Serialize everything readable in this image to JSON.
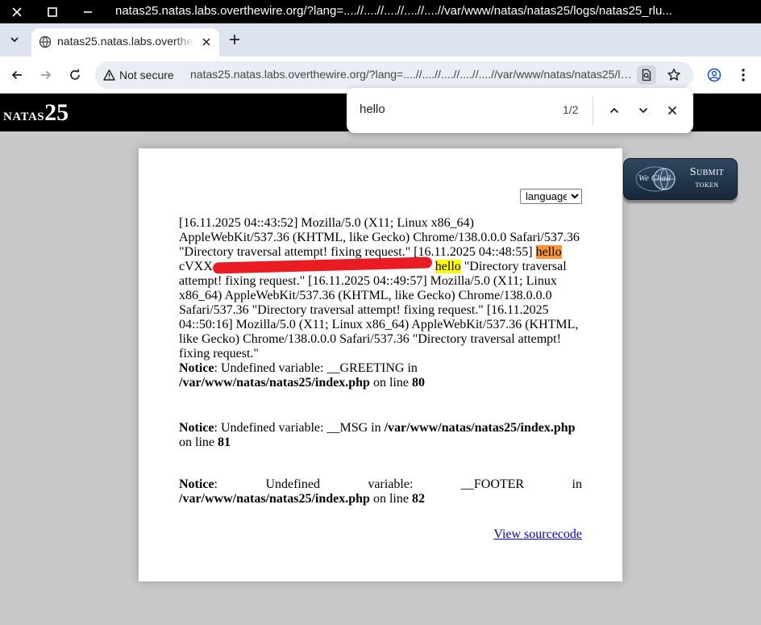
{
  "window": {
    "title": "natas25.natas.labs.overthewire.org/?lang=....//....//....//....//....//var/www/natas/natas25/logs/natas25_rlu..."
  },
  "tab": {
    "title": "natas25.natas.labs.overthewire.org"
  },
  "toolbar": {
    "security_label": "Not secure",
    "url": "natas25.natas.labs.overthewire.org/?lang=....//....//....//....//....//var/www/natas/natas25/logs/natas25_rlu..."
  },
  "find": {
    "query": "hello",
    "count": "1/2"
  },
  "site": {
    "logo_prefix": "natas",
    "logo_number": "25",
    "language_label": "language",
    "log_1": "[16.11.2025 04::43:52] Mozilla/5.0 (X11; Linux x86_64) AppleWebKit/537.36 (KHTML, like Gecko) Chrome/138.0.0.0 Safari/537.36 \"Directory traversal attempt! fixing request.\" [16.11.2025 04::48:55] ",
    "match_1": "hello",
    "redacted_prefix": "cVXX",
    "match_2": "hello",
    "log_2": " \"Directory traversal attempt! fixing request.\" [16.11.2025 04::49:57] Mozilla/5.0 (X11; Linux x86_64) AppleWebKit/537.36 (KHTML, like Gecko) Chrome/138.0.0.0 Safari/537.36 \"Directory traversal attempt! fixing request.\" [16.11.2025 04::50:16] Mozilla/5.0 (X11; Linux x86_64) AppleWebKit/537.36 (KHTML, like Gecko) Chrome/138.0.0.0 Safari/537.36 \"Directory traversal attempt! fixing request.\"",
    "notices": [
      {
        "label": "Notice",
        "message": ": Undefined variable: __GREETING in ",
        "file": "/var/www/natas/natas25/index.php",
        "on_line": " on line ",
        "line": "80"
      },
      {
        "label": "Notice",
        "message": ": Undefined variable: __MSG in ",
        "file": "/var/www/natas/natas25/index.php",
        "on_line": " on line ",
        "line": "81"
      },
      {
        "label": "Notice",
        "message": ": Undefined variable: __FOOTER in",
        "file": "/var/www/natas/natas25/index.php",
        "on_line": " on line ",
        "line": "82"
      }
    ],
    "view_source": "View sourcecode"
  },
  "wechall": {
    "logo_text": "We Chall",
    "submit": "Submit",
    "token": "token"
  },
  "colors": {
    "find_active_match": "#ff9632",
    "find_match": "#ffff00",
    "redaction": "#e81c22",
    "link": "#0000cc"
  }
}
